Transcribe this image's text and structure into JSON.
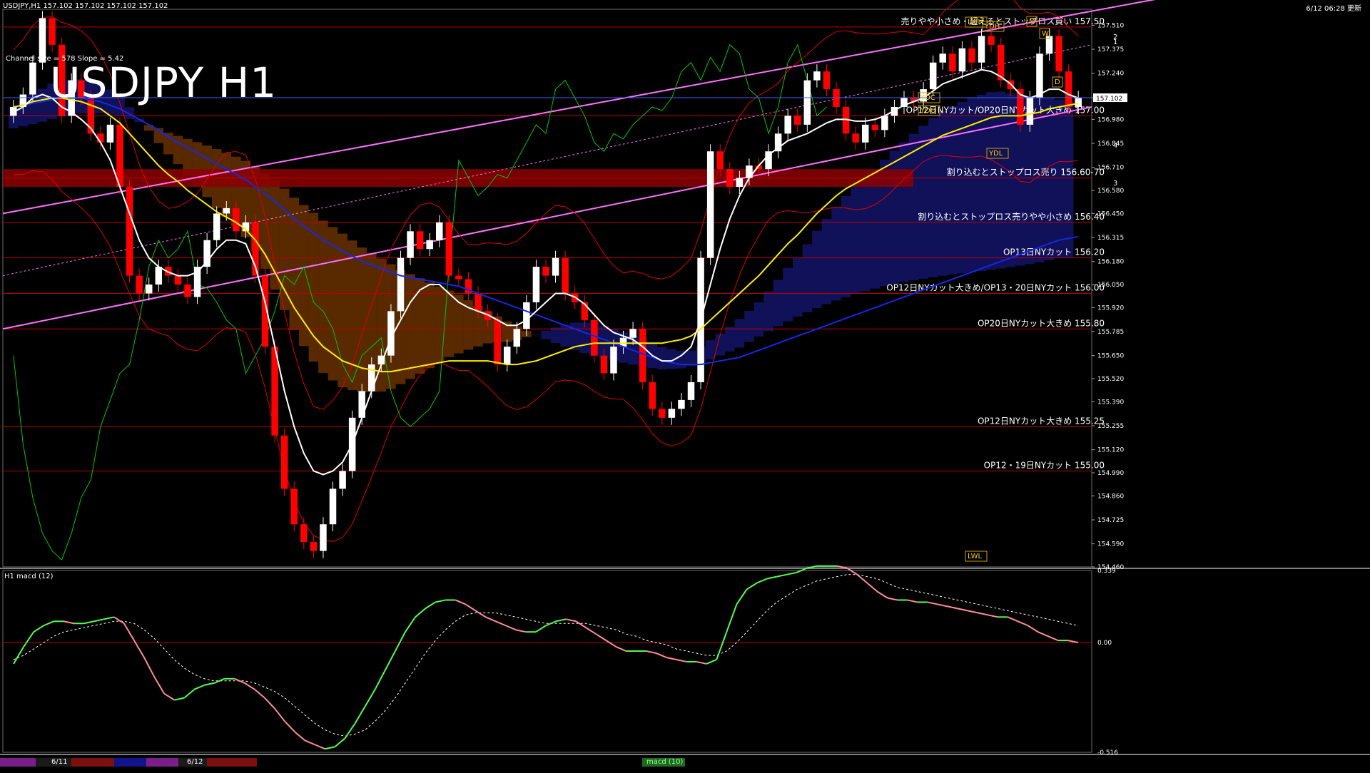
{
  "header": {
    "symbol_info": "USDJPY,H1  157.102 157.102 157.102 157.102",
    "update_info": "6/12 06:28 更新"
  },
  "title": "USDJPY H1",
  "channel_info": "Channel size = 578 Slope = 5.42",
  "subwindow_title": "H1  macd (12)",
  "date_labels": [
    "6/11",
    "6/12"
  ],
  "bottom_tab": "macd (10)",
  "colors": {
    "background": "#000000",
    "bull_candle": "#ffffff",
    "bear_candle": "#ff0000",
    "support_line": "#c00000",
    "channel": "#ff70ff",
    "ma_white": "#ffffff",
    "ma_yellow": "#ffee00",
    "ma_blue": "#1428e6",
    "bollinger": "#e00000",
    "chikou": "#00c800",
    "cloud_orange": "#ff7800",
    "cloud_blue": "#3232ff",
    "macd_up": "#50ff50",
    "macd_down": "#ff8c9c",
    "zone": "#8c0000"
  },
  "chart_data": [
    {
      "type": "candlestick",
      "title": "USDJPY H1",
      "ylim": [
        154.46,
        157.6
      ],
      "y_ticks": [
        "157.510",
        "157.375",
        "157.240",
        "157.102",
        "156.980",
        "156.845",
        "156.710",
        "156.580",
        "156.450",
        "156.315",
        "156.180",
        "156.050",
        "155.920",
        "155.785",
        "155.650",
        "155.520",
        "155.390",
        "155.255",
        "155.120",
        "154.990",
        "154.860",
        "154.725",
        "154.590",
        "154.460"
      ],
      "current_price": "157.102",
      "closes": [
        157.05,
        157.12,
        157.3,
        157.55,
        157.4,
        157.0,
        157.2,
        157.1,
        156.9,
        156.85,
        156.95,
        156.6,
        156.1,
        156.0,
        156.05,
        156.15,
        156.1,
        156.05,
        155.98,
        156.15,
        156.3,
        156.45,
        156.48,
        156.35,
        156.4,
        156.1,
        155.7,
        155.2,
        154.9,
        154.7,
        154.6,
        154.55,
        154.7,
        154.9,
        155.0,
        155.3,
        155.45,
        155.6,
        155.65,
        155.9,
        156.2,
        156.35,
        156.25,
        156.3,
        156.4,
        156.1,
        156.08,
        156.0,
        155.9,
        155.85,
        155.6,
        155.7,
        155.8,
        155.95,
        156.15,
        156.1,
        156.2,
        156.0,
        155.95,
        155.85,
        155.65,
        155.55,
        155.7,
        155.75,
        155.8,
        155.5,
        155.35,
        155.3,
        155.35,
        155.4,
        155.5,
        156.2,
        156.8,
        156.7,
        156.6,
        156.65,
        156.72,
        156.7,
        156.8,
        156.9,
        157.0,
        156.95,
        157.2,
        157.25,
        157.15,
        157.05,
        156.9,
        156.85,
        156.95,
        156.92,
        157.0,
        157.05,
        157.1,
        157.08,
        157.15,
        157.3,
        157.35,
        157.25,
        157.38,
        157.3,
        157.45,
        157.4,
        157.2,
        157.15,
        156.95,
        157.1,
        157.35,
        157.45,
        157.25,
        157.05,
        157.1
      ],
      "ma_white": [
        157.02,
        157.05,
        157.1,
        157.12,
        157.1,
        157.05,
        157.02,
        156.98,
        156.93,
        156.85,
        156.75,
        156.6,
        156.45,
        156.3,
        156.2,
        156.15,
        156.12,
        156.1,
        156.1,
        156.12,
        156.18,
        156.25,
        156.3,
        156.3,
        156.28,
        156.15,
        155.95,
        155.7,
        155.45,
        155.25,
        155.1,
        155.0,
        154.98,
        155.0,
        155.05,
        155.15,
        155.3,
        155.45,
        155.6,
        155.75,
        155.85,
        155.95,
        156.02,
        156.05,
        156.05,
        156.0,
        155.95,
        155.92,
        155.9,
        155.88,
        155.85,
        155.82,
        155.82,
        155.85,
        155.9,
        155.95,
        156.0,
        156.0,
        155.98,
        155.94,
        155.88,
        155.82,
        155.78,
        155.76,
        155.74,
        155.7,
        155.65,
        155.62,
        155.62,
        155.65,
        155.7,
        155.85,
        156.05,
        156.25,
        156.42,
        156.55,
        156.65,
        156.72,
        156.78,
        156.82,
        156.86,
        156.88,
        156.9,
        156.93,
        156.96,
        156.98,
        156.98,
        156.97,
        156.97,
        156.98,
        157.0,
        157.03,
        157.06,
        157.08,
        157.1,
        157.14,
        157.18,
        157.2,
        157.22,
        157.24,
        157.26,
        157.25,
        157.22,
        157.18,
        157.12,
        157.1,
        157.12,
        157.15,
        157.15,
        157.12,
        157.1
      ],
      "ma_yellow": [
        157.05,
        157.06,
        157.08,
        157.09,
        157.1,
        157.1,
        157.09,
        157.08,
        157.06,
        157.04,
        157.0,
        156.96,
        156.9,
        156.84,
        156.78,
        156.72,
        156.67,
        156.63,
        156.58,
        156.54,
        156.5,
        156.46,
        156.43,
        156.4,
        156.36,
        156.3,
        156.22,
        156.12,
        156.02,
        155.92,
        155.84,
        155.76,
        155.7,
        155.66,
        155.62,
        155.6,
        155.58,
        155.57,
        155.56,
        155.56,
        155.57,
        155.58,
        155.59,
        155.6,
        155.61,
        155.62,
        155.62,
        155.62,
        155.62,
        155.62,
        155.61,
        155.6,
        155.6,
        155.61,
        155.62,
        155.64,
        155.66,
        155.68,
        155.7,
        155.71,
        155.72,
        155.72,
        155.72,
        155.72,
        155.72,
        155.72,
        155.72,
        155.72,
        155.73,
        155.74,
        155.76,
        155.8,
        155.85,
        155.9,
        155.95,
        156.0,
        156.05,
        156.1,
        156.16,
        156.22,
        156.28,
        156.33,
        156.39,
        156.45,
        156.5,
        156.55,
        156.59,
        156.62,
        156.65,
        156.68,
        156.71,
        156.74,
        156.77,
        156.8,
        156.83,
        156.86,
        156.89,
        156.91,
        156.93,
        156.95,
        156.97,
        156.99,
        157.0,
        157.0,
        157.0,
        157.01,
        157.02,
        157.04,
        157.05,
        157.06,
        157.07
      ],
      "ma_blue": [
        157.05,
        157.06,
        157.07,
        157.08,
        157.09,
        157.1,
        157.1,
        157.1,
        157.09,
        157.08,
        157.06,
        157.04,
        157.01,
        156.98,
        156.95,
        156.92,
        156.88,
        156.85,
        156.82,
        156.79,
        156.76,
        156.73,
        156.7,
        156.67,
        156.64,
        156.6,
        156.56,
        156.52,
        156.47,
        156.42,
        156.38,
        156.34,
        156.3,
        156.27,
        156.24,
        156.21,
        156.18,
        156.16,
        156.14,
        156.12,
        156.1,
        156.09,
        156.08,
        156.07,
        156.06,
        156.05,
        156.04,
        156.02,
        156.0,
        155.98,
        155.96,
        155.94,
        155.92,
        155.9,
        155.88,
        155.86,
        155.84,
        155.82,
        155.8,
        155.78,
        155.76,
        155.74,
        155.72,
        155.7,
        155.68,
        155.66,
        155.64,
        155.62,
        155.61,
        155.6,
        155.6,
        155.6,
        155.61,
        155.62,
        155.63,
        155.64,
        155.66,
        155.68,
        155.7,
        155.72,
        155.74,
        155.76,
        155.78,
        155.8,
        155.82,
        155.84,
        155.86,
        155.88,
        155.9,
        155.92,
        155.94,
        155.96,
        155.98,
        156.0,
        156.02,
        156.04,
        156.06,
        156.08,
        156.1,
        156.12,
        156.14,
        156.16,
        156.18,
        156.2,
        156.22,
        156.24,
        156.26,
        156.28,
        156.3,
        156.31,
        156.32
      ],
      "horizontal_levels": [
        {
          "price": 157.5,
          "label": "売りやや小さめ・超えるとストップロス買い 157.50"
        },
        {
          "price": 157.0,
          "label": "OP12日NYカット/OP20日NYカット大きめ 157.00"
        },
        {
          "price": 156.65,
          "label": "割り込むとストップロス売り 156.60-70"
        },
        {
          "price": 156.4,
          "label": "割り込むとストップロス売りやや小さめ 156.40"
        },
        {
          "price": 156.2,
          "label": "OP13日NYカット 156.20"
        },
        {
          "price": 156.0,
          "label": "OP12日NYカット大きめ/OP13・20日NYカット 156.00"
        },
        {
          "price": 155.8,
          "label": "OP20日NYカット大きめ 155.80"
        },
        {
          "price": 155.25,
          "label": "OP12日NYカット大きめ 155.25"
        },
        {
          "price": 155.0,
          "label": "OP12・19日NYカット 155.00"
        }
      ],
      "zone": {
        "from": 156.6,
        "to": 156.7
      },
      "markers": [
        "YDH",
        "YDC",
        "YDO",
        "YDL",
        "LWH",
        "LWL",
        "W",
        "M",
        "D",
        "1",
        "2",
        "3",
        "4"
      ]
    },
    {
      "type": "line",
      "title": "H1  macd (12)",
      "ylim": [
        -0.516,
        0.339
      ],
      "y_ticks": [
        "0.339",
        "0.00",
        "-0.516"
      ],
      "macd": [
        -0.1,
        -0.02,
        0.05,
        0.08,
        0.1,
        0.1,
        0.09,
        0.09,
        0.1,
        0.11,
        0.12,
        0.09,
        0.01,
        -0.07,
        -0.16,
        -0.24,
        -0.27,
        -0.26,
        -0.22,
        -0.2,
        -0.19,
        -0.17,
        -0.17,
        -0.19,
        -0.22,
        -0.26,
        -0.31,
        -0.37,
        -0.42,
        -0.46,
        -0.48,
        -0.5,
        -0.49,
        -0.45,
        -0.38,
        -0.3,
        -0.22,
        -0.13,
        -0.04,
        0.05,
        0.12,
        0.16,
        0.19,
        0.2,
        0.2,
        0.18,
        0.15,
        0.12,
        0.1,
        0.08,
        0.06,
        0.05,
        0.05,
        0.08,
        0.1,
        0.11,
        0.1,
        0.07,
        0.04,
        0.01,
        -0.02,
        -0.04,
        -0.04,
        -0.04,
        -0.05,
        -0.07,
        -0.08,
        -0.09,
        -0.09,
        -0.1,
        -0.08,
        0.05,
        0.18,
        0.25,
        0.28,
        0.3,
        0.31,
        0.32,
        0.33,
        0.35,
        0.36,
        0.36,
        0.36,
        0.35,
        0.32,
        0.28,
        0.24,
        0.21,
        0.2,
        0.2,
        0.19,
        0.19,
        0.18,
        0.17,
        0.16,
        0.15,
        0.14,
        0.13,
        0.12,
        0.12,
        0.1,
        0.08,
        0.05,
        0.03,
        0.01,
        0.01,
        0.0
      ],
      "signal": [
        -0.08,
        -0.06,
        -0.03,
        0.0,
        0.03,
        0.05,
        0.06,
        0.07,
        0.08,
        0.09,
        0.1,
        0.1,
        0.09,
        0.06,
        0.02,
        -0.03,
        -0.08,
        -0.12,
        -0.15,
        -0.17,
        -0.18,
        -0.18,
        -0.18,
        -0.18,
        -0.19,
        -0.21,
        -0.23,
        -0.26,
        -0.3,
        -0.34,
        -0.38,
        -0.41,
        -0.43,
        -0.44,
        -0.43,
        -0.41,
        -0.37,
        -0.32,
        -0.26,
        -0.19,
        -0.12,
        -0.05,
        0.01,
        0.06,
        0.1,
        0.13,
        0.14,
        0.14,
        0.14,
        0.13,
        0.12,
        0.11,
        0.1,
        0.09,
        0.09,
        0.09,
        0.09,
        0.09,
        0.08,
        0.07,
        0.06,
        0.04,
        0.03,
        0.01,
        0.0,
        -0.01,
        -0.03,
        -0.04,
        -0.05,
        -0.06,
        -0.06,
        -0.04,
        0.0,
        0.05,
        0.1,
        0.15,
        0.19,
        0.22,
        0.25,
        0.27,
        0.29,
        0.3,
        0.31,
        0.32,
        0.32,
        0.31,
        0.3,
        0.28,
        0.26,
        0.25,
        0.24,
        0.23,
        0.22,
        0.21,
        0.2,
        0.19,
        0.18,
        0.17,
        0.16,
        0.15,
        0.14,
        0.13,
        0.12,
        0.11,
        0.1,
        0.09,
        0.08
      ]
    }
  ]
}
